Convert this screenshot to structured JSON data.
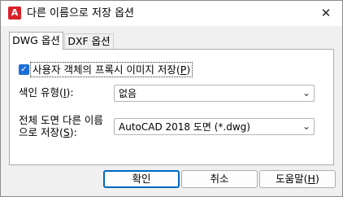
{
  "window": {
    "title": "다른 이름으로 저장 옵션",
    "app_icon_letter": "A",
    "close_glyph": "✕"
  },
  "tabs": [
    {
      "label": "DWG 옵션",
      "active": true
    },
    {
      "label": "DXF 옵션",
      "active": false
    }
  ],
  "dwg_options": {
    "proxy_images": {
      "label_prefix": "사용자 객체의 프록시 이미지 저장(",
      "mnemonic": "P",
      "label_suffix": ")",
      "checked": true,
      "check_glyph": "✓"
    },
    "index_type": {
      "label_prefix": "색인 유형(",
      "mnemonic": "I",
      "label_suffix": "):",
      "value": "없음"
    },
    "save_all_drawings": {
      "label_line1": "전체 도면 다른 이름",
      "label_line2_prefix": "으로 저장(",
      "mnemonic": "S",
      "label_line2_suffix": "):",
      "value": "AutoCAD 2018 도면 (*.dwg)"
    },
    "dropdown_glyph": "⌄"
  },
  "buttons": {
    "ok": "확인",
    "cancel": "취소",
    "help_prefix": "도움말(",
    "help_mnemonic": "H",
    "help_suffix": ")"
  },
  "colors": {
    "accent": "#0067c0",
    "checkbox": "#1a6fd6",
    "autocad_red": "#d8232a"
  }
}
